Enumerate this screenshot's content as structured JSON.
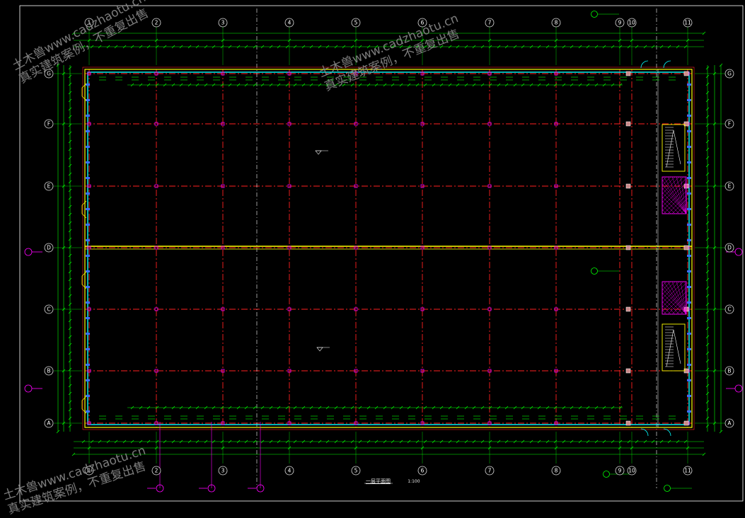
{
  "drawing": {
    "title": "一层平面图",
    "scale": "1:100",
    "row_axes": [
      "G",
      "F",
      "E",
      "D",
      "C",
      "B",
      "A"
    ],
    "col_axes": [
      "1",
      "2",
      "3",
      "4",
      "5",
      "6",
      "7",
      "8",
      "9",
      "10",
      "11"
    ]
  },
  "watermarks": [
    {
      "line1": "土木兽www.cadzhaotu.cn",
      "line2": "真实建筑案例，不重复出售"
    },
    {
      "line1": "土木兽www.cadzhaotu.cn",
      "line2": "真实建筑案例，不重复出售"
    },
    {
      "line1": "土木兽www.cadzhaotu.cn",
      "line2": "真实建筑案例，不重复出售"
    }
  ],
  "colors": {
    "background": "#000000",
    "axis_line": "#ff2020",
    "dim_line": "#00ff00",
    "wall": "#ffff00",
    "glass": "#00ffff",
    "column": "#ff00ff",
    "frame": "#ffffff",
    "hatch": "#ff00ff",
    "blue_detail": "#3c6cff"
  }
}
